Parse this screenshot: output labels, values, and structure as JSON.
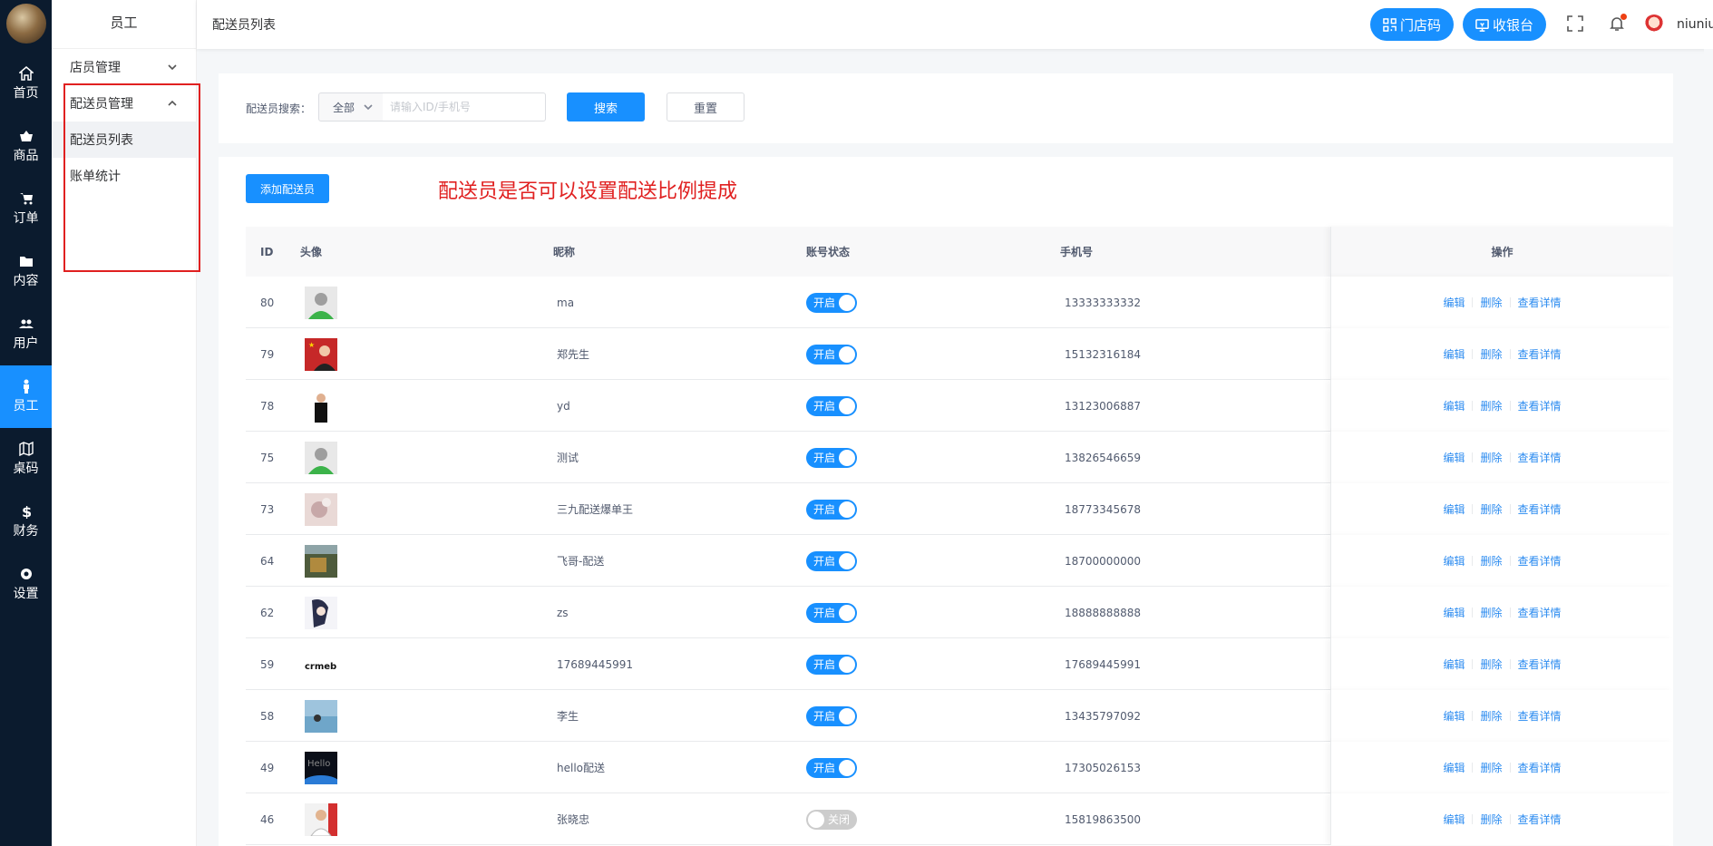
{
  "rail": {
    "items": [
      {
        "label": "首页",
        "icon": "home-icon"
      },
      {
        "label": "商品",
        "icon": "basket-icon"
      },
      {
        "label": "订单",
        "icon": "cart-icon"
      },
      {
        "label": "内容",
        "icon": "folder-icon"
      },
      {
        "label": "用户",
        "icon": "users-icon"
      },
      {
        "label": "员工",
        "icon": "person-icon",
        "active": true
      },
      {
        "label": "桌码",
        "icon": "map-icon"
      },
      {
        "label": "财务",
        "icon": "dollar-icon"
      },
      {
        "label": "设置",
        "icon": "gear-icon"
      }
    ]
  },
  "subnav": {
    "title": "员工",
    "group1": "店员管理",
    "group2": "配送员管理",
    "item1": "配送员列表",
    "item2": "账单统计"
  },
  "header": {
    "breadcrumb": "配送员列表",
    "store_qr_label": "门店码",
    "cashier_label": "收银台",
    "username": "niuniu"
  },
  "search": {
    "label": "配送员搜索：",
    "select_value": "全部",
    "input_placeholder": "请输入ID/手机号",
    "search_button": "搜索",
    "reset_button": "重置"
  },
  "table": {
    "add_button": "添加配送员",
    "note": "配送员是否可以设置配送比例提成",
    "columns": {
      "id": "ID",
      "avatar": "头像",
      "nickname": "昵称",
      "status": "账号状态",
      "phone": "手机号",
      "actions": "操作"
    },
    "action_labels": {
      "edit": "编辑",
      "delete": "删除",
      "detail": "查看详情"
    },
    "status_labels": {
      "on": "开启",
      "off": "关闭"
    },
    "rows": [
      {
        "id": "80",
        "nickname": "ma",
        "phone": "13333333332",
        "on": true,
        "avatar": "default"
      },
      {
        "id": "79",
        "nickname": "郑先生",
        "phone": "15132316184",
        "on": true,
        "avatar": "flag"
      },
      {
        "id": "78",
        "nickname": "yd",
        "phone": "13123006887",
        "on": true,
        "avatar": "suit"
      },
      {
        "id": "75",
        "nickname": "测试",
        "phone": "13826546659",
        "on": true,
        "avatar": "default"
      },
      {
        "id": "73",
        "nickname": "三九配送爆单王",
        "phone": "18773345678",
        "on": true,
        "avatar": "soft"
      },
      {
        "id": "64",
        "nickname": "飞哥-配送",
        "phone": "18700000000",
        "on": true,
        "avatar": "dark"
      },
      {
        "id": "62",
        "nickname": "zs",
        "phone": "18888888888",
        "on": true,
        "avatar": "anime"
      },
      {
        "id": "59",
        "nickname": "17689445991",
        "phone": "17689445991",
        "on": true,
        "avatar": "crmeb"
      },
      {
        "id": "58",
        "nickname": "李生",
        "phone": "13435797092",
        "on": true,
        "avatar": "sea"
      },
      {
        "id": "49",
        "nickname": "hello配送",
        "phone": "17305026153",
        "on": true,
        "avatar": "hello"
      },
      {
        "id": "46",
        "nickname": "张晓忠",
        "phone": "15819863500",
        "on": false,
        "avatar": "red"
      }
    ]
  },
  "avatar_texts": {
    "crmeb": "crmeb",
    "hello": "Hello"
  }
}
